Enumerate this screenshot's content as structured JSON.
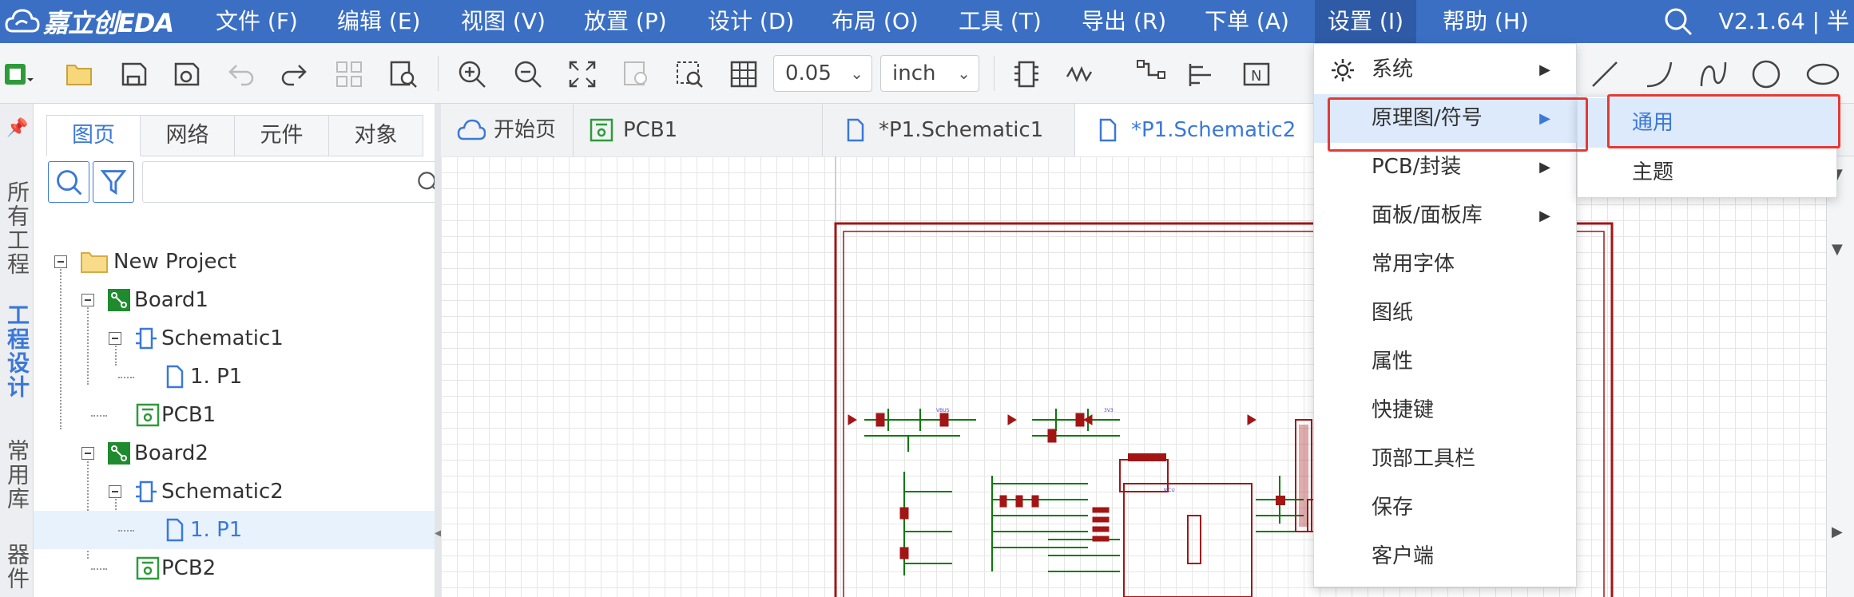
{
  "app": {
    "logo_text": "嘉立创EDA",
    "version": "V2.1.64 | 半"
  },
  "menubar": {
    "items": [
      "文件 (F)",
      "编辑 (E)",
      "视图 (V)",
      "放置 (P)",
      "设计 (D)",
      "布局 (O)",
      "工具 (T)",
      "导出 (R)",
      "下单 (A)",
      "设置 (I)",
      "帮助 (H)"
    ],
    "active_index": 9
  },
  "toolbar": {
    "grid_value": "0.05",
    "unit_value": "inch",
    "icons": [
      "new-icon",
      "open-folder-icon",
      "save-icon",
      "save-version-icon",
      "undo-icon",
      "redo-icon",
      "align-grid-icon",
      "find-icon",
      "zoom-in-icon",
      "zoom-out-icon",
      "fit-icon",
      "zoom-selection-icon",
      "zoom-area-icon",
      "grid-icon",
      "component-icon",
      "wire-icon",
      "bus-icon",
      "netlabel-icon",
      "netport-icon",
      "line-icon",
      "arc-icon",
      "bezier-icon",
      "circle-icon",
      "ellipse-icon"
    ]
  },
  "vertical_tabs": [
    "所有工程",
    "工程设计",
    "常用库",
    "器件"
  ],
  "vertical_active_index": 1,
  "panel": {
    "tabs": [
      "图页",
      "网络",
      "元件",
      "对象"
    ],
    "active_tab": 0,
    "search_placeholder": ""
  },
  "tree": [
    {
      "label": "New Project",
      "type": "folder",
      "depth": 0
    },
    {
      "label": "Board1",
      "type": "board",
      "depth": 1
    },
    {
      "label": "Schematic1",
      "type": "schematic",
      "depth": 2
    },
    {
      "label": "1. P1",
      "type": "page",
      "depth": 3
    },
    {
      "label": "PCB1",
      "type": "pcb",
      "depth": 2
    },
    {
      "label": "Board2",
      "type": "board",
      "depth": 1
    },
    {
      "label": "Schematic2",
      "type": "schematic",
      "depth": 2
    },
    {
      "label": "1. P1",
      "type": "page",
      "depth": 3,
      "selected": true
    },
    {
      "label": "PCB2",
      "type": "pcb",
      "depth": 2
    }
  ],
  "doc_tabs": [
    {
      "label": "开始页",
      "icon": "cloud-icon"
    },
    {
      "label": "PCB1",
      "icon": "pcb-icon"
    },
    {
      "label": "*P1.Schematic1",
      "icon": "doc-icon"
    },
    {
      "label": "*P1.Schematic2",
      "icon": "doc-icon",
      "active": true
    }
  ],
  "settings_menu": {
    "items": [
      {
        "label": "系统",
        "icon": "gear-icon",
        "has_sub": true
      },
      {
        "label": "原理图/符号",
        "has_sub": true,
        "highlighted": true
      },
      {
        "label": "PCB/封装",
        "has_sub": true
      },
      {
        "label": "面板/面板库",
        "has_sub": true
      },
      {
        "label": "常用字体"
      },
      {
        "label": "图纸"
      },
      {
        "label": "属性"
      },
      {
        "label": "快捷键"
      },
      {
        "label": "顶部工具栏"
      },
      {
        "label": "保存"
      },
      {
        "label": "客户端"
      }
    ]
  },
  "submenu": {
    "items": [
      {
        "label": "通用",
        "highlighted": true
      },
      {
        "label": "主题"
      }
    ]
  },
  "colors": {
    "menubar": "#3b6fc4",
    "accent": "#3b78d8",
    "highlight_box": "#e53935",
    "schematic_red": "#a31515",
    "schematic_green": "#0b7a0b"
  }
}
